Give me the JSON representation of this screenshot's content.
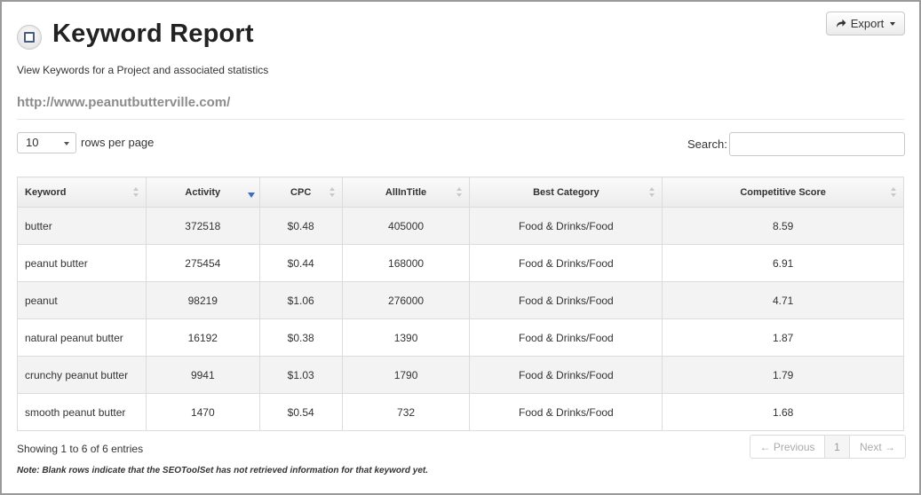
{
  "header": {
    "icon": "checkbox-square-icon",
    "title": "Keyword Report",
    "subtitle": "View Keywords for a Project and associated statistics",
    "project_url": "http://www.peanutbutterville.com/",
    "export_label": "Export",
    "export_icon": "share-arrow-icon"
  },
  "controls": {
    "rows_per_page_value": "10",
    "rows_per_page_label": "rows per page",
    "search_label": "Search:",
    "search_value": ""
  },
  "table": {
    "columns": [
      "Keyword",
      "Activity",
      "CPC",
      "AllInTitle",
      "Best Category",
      "Competitive Score"
    ],
    "sorted_column": "Activity",
    "sort_direction": "descending",
    "rows": [
      [
        "butter",
        "372518",
        "$0.48",
        "405000",
        "Food & Drinks/Food",
        "8.59"
      ],
      [
        "peanut butter",
        "275454",
        "$0.44",
        "168000",
        "Food & Drinks/Food",
        "6.91"
      ],
      [
        "peanut",
        "98219",
        "$1.06",
        "276000",
        "Food & Drinks/Food",
        "4.71"
      ],
      [
        "natural peanut butter",
        "16192",
        "$0.38",
        "1390",
        "Food & Drinks/Food",
        "1.87"
      ],
      [
        "crunchy peanut butter",
        "9941",
        "$1.03",
        "1790",
        "Food & Drinks/Food",
        "1.79"
      ],
      [
        "smooth peanut butter",
        "1470",
        "$0.54",
        "732",
        "Food & Drinks/Food",
        "1.68"
      ]
    ]
  },
  "footer": {
    "info": "Showing 1 to 6 of 6 entries",
    "prev_label": "← Previous",
    "page": "1",
    "next_label": "Next →",
    "note": "Note: Blank rows indicate that the SEOToolSet has not retrieved information for that keyword yet."
  },
  "colors": {
    "sort_indicator": "#3a6fc6",
    "url_text": "#8c8c8c"
  }
}
